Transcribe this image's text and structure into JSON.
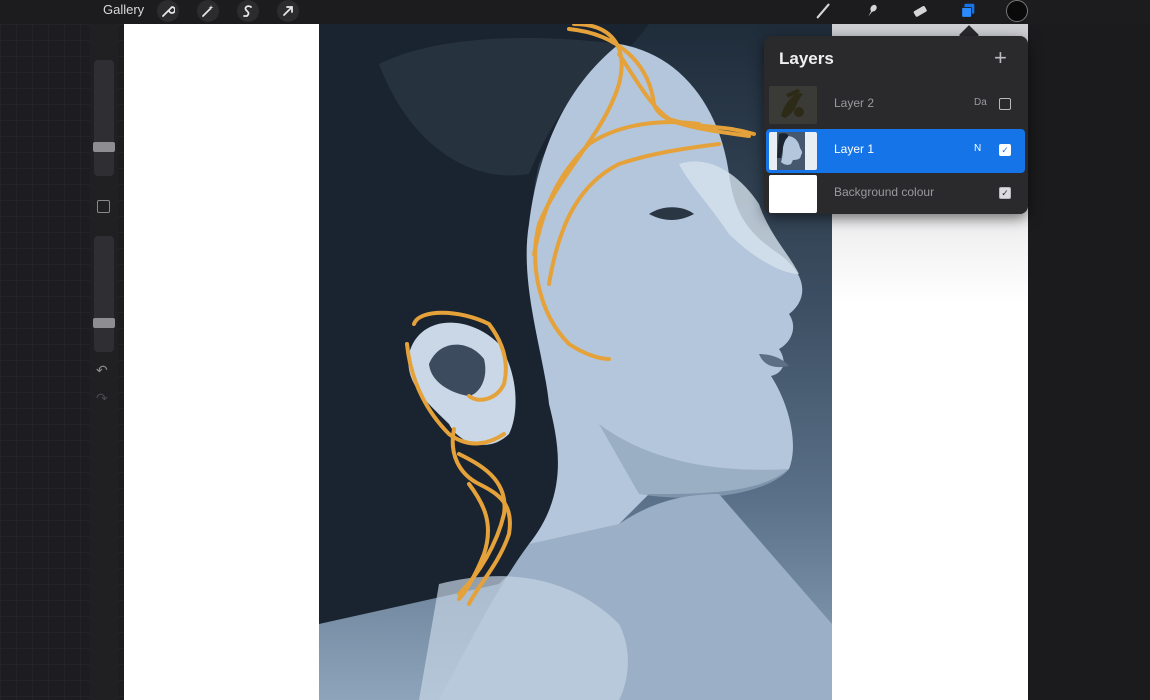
{
  "toolbar": {
    "gallery_label": "Gallery",
    "left_tools": [
      "wrench-icon",
      "magic-wand-icon",
      "selection-icon",
      "transform-arrow-icon"
    ],
    "right_tools": [
      "brush-icon",
      "smudge-icon",
      "eraser-icon",
      "layers-icon"
    ],
    "active_tool": "layers-icon",
    "current_color": "#0a0a0a"
  },
  "sidebar": {
    "brush_size_level": 0.75,
    "opacity_level": 0.75,
    "icons": [
      "modify-square-icon",
      "undo-icon",
      "redo-icon"
    ]
  },
  "layers_panel": {
    "title": "Layers",
    "add_icon": "plus-icon",
    "layers": [
      {
        "name": "Layer 2",
        "blend": "Da",
        "visible": false,
        "active": false
      },
      {
        "name": "Layer 1",
        "blend": "N",
        "visible": true,
        "active": true
      },
      {
        "name": "Background colour",
        "blend": "",
        "visible": true,
        "active": false
      }
    ]
  },
  "colors": {
    "accent": "#1574e8",
    "sketch": "#e5a23a",
    "panel": "#2a2a2d"
  }
}
